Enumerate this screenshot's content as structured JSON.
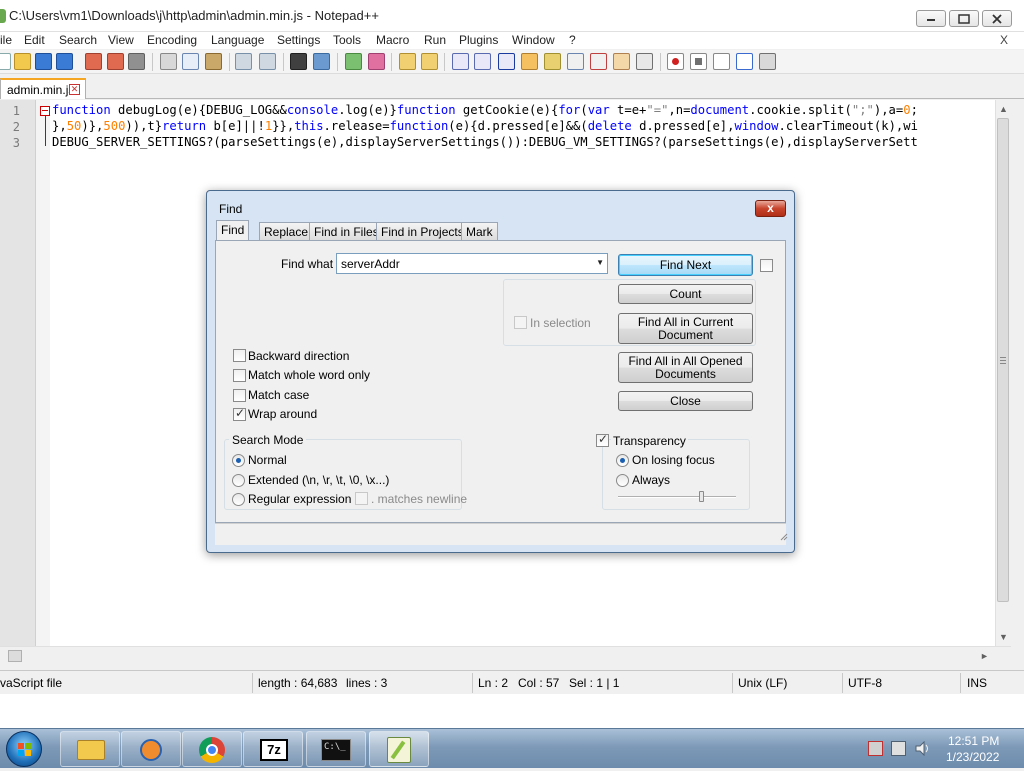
{
  "window": {
    "title": "C:\\Users\\vm1\\Downloads\\j\\http\\admin\\admin.min.js - Notepad++"
  },
  "menu": {
    "items": [
      "ile",
      "Edit",
      "Search",
      "View",
      "Encoding",
      "Language",
      "Settings",
      "Tools",
      "Macro",
      "Run",
      "Plugins",
      "Window",
      "?"
    ],
    "close": "X"
  },
  "toolbar": {
    "icons": [
      "new-file-icon",
      "open-file-icon",
      "save-icon",
      "save-all-icon",
      "close-icon",
      "close-all-icon",
      "print-icon",
      "cut-icon",
      "copy-icon",
      "paste-icon",
      "undo-icon",
      "redo-icon",
      "find-icon",
      "replace-icon",
      "zoom-in-icon",
      "zoom-out-icon",
      "sync-v-icon",
      "sync-h-icon",
      "word-wrap-icon",
      "show-all-chars-icon",
      "indent-guide-icon",
      "doc-map-icon",
      "function-list-icon",
      "folder-workspace-icon",
      "monitoring-icon",
      "record-macro-icon",
      "stop-macro-icon",
      "play-macro-icon",
      "run-macro-multiple-icon",
      "save-macro-icon"
    ]
  },
  "tab": {
    "label": "admin.min.js"
  },
  "editor": {
    "line_numbers": [
      "1",
      "2",
      "3"
    ],
    "lines": [
      "function debugLog(e){DEBUG_LOG&&console.log(e)}function getCookie(e){for(var t=e+\"=\",n=document.cookie.split(\";\"),a=0;",
      "},50)},500)),t}return b[e]||!1}},this.release=function(e){d.pressed[e]&&(delete d.pressed[e],window.clearTimeout(k),wi",
      "DEBUG_SERVER_SETTINGS?(parseSettings(e),displayServerSettings()):DEBUG_VM_SETTINGS?(parseSettings(e),displayServerSett"
    ]
  },
  "status": {
    "file_type": "vaScript file",
    "length": "length : 64,683",
    "lines": "lines : 3",
    "ln": "Ln : 2",
    "col": "Col : 57",
    "sel": "Sel : 1 | 1",
    "eol": "Unix (LF)",
    "encoding": "UTF-8",
    "mode": "INS"
  },
  "taskbar": {
    "time": "12:51 PM",
    "date": "1/23/2022",
    "apps": [
      "windows-explorer-icon",
      "media-player-icon",
      "chrome-icon",
      "7zip-icon",
      "cmd-icon",
      "notepadpp-icon"
    ]
  },
  "find_dialog": {
    "title": "Find",
    "close": "x",
    "tabs": [
      "Find",
      "Replace",
      "Find in Files",
      "Find in Projects",
      "Mark"
    ],
    "selected_tab": "Find",
    "find_what_label": "Find what :",
    "find_what_value": "serverAddr",
    "in_selection": "In selection",
    "options": {
      "backward": {
        "label": "Backward direction",
        "checked": false
      },
      "whole_word": {
        "label": "Match whole word only",
        "checked": false
      },
      "match_case": {
        "label": "Match case",
        "checked": false
      },
      "wrap_around": {
        "label": "Wrap around",
        "checked": true
      }
    },
    "search_mode": {
      "title": "Search Mode",
      "normal": "Normal",
      "extended": "Extended (\\n, \\r, \\t, \\0, \\x...)",
      "regex": "Regular expression",
      "matches_newline": ". matches newline",
      "selected": "Normal"
    },
    "transparency": {
      "title": "Transparency",
      "enabled": true,
      "on_losing_focus": "On losing focus",
      "always": "Always",
      "selected": "On losing focus",
      "level": 0.7
    },
    "buttons": {
      "find_next": "Find Next",
      "count": "Count",
      "find_all_current_1": "Find All in Current",
      "find_all_current_2": "Document",
      "find_all_opened_1": "Find All in All Opened",
      "find_all_opened_2": "Documents",
      "close": "Close"
    }
  }
}
